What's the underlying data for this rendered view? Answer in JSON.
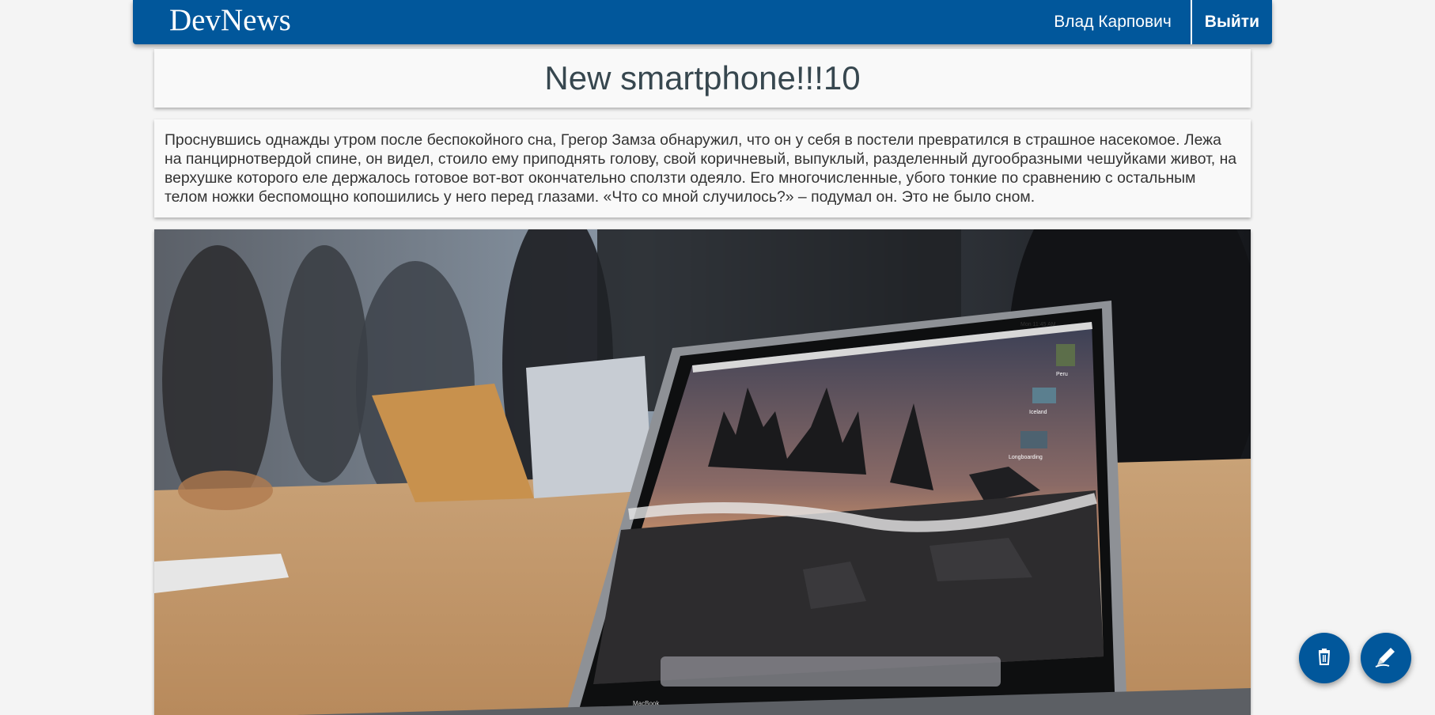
{
  "header": {
    "brand": "DevNews",
    "user_name": "Влад Карпович",
    "logout_label": "Выйти"
  },
  "article": {
    "title": "New smartphone!!!10",
    "body": "Проснувшись однажды утром после беспокойного сна, Грегор Замза обнаружил, что он у себя в постели превратился в страшное насекомое. Лежа на панцирнотвердой спине, он видел, стоило ему приподнять голову, свой коричневый, выпуклый, разделенный дугообразными чешуйками живот, на верхушке которого еле держалось готовое вот-вот окончательно сползти одеяло. Его многочисленные, убого тонкие по сравнению с остальным телом ножки беспомощно копошились у него перед глазами. «Что со мной случилось?» – подумал он. Это не было сном.",
    "image": {
      "screen_clock": "Mon 11:45 AM",
      "desktop_labels": [
        "Peru",
        "Iceland",
        "Longboarding"
      ],
      "laptop_brand": "MacBook"
    }
  },
  "actions": {
    "delete_icon": "trash-icon",
    "edit_icon": "pen-icon"
  },
  "colors": {
    "primary": "#01579b",
    "background": "#f4f4f4",
    "card": "#f9f9f9",
    "title_text": "#37474f"
  }
}
